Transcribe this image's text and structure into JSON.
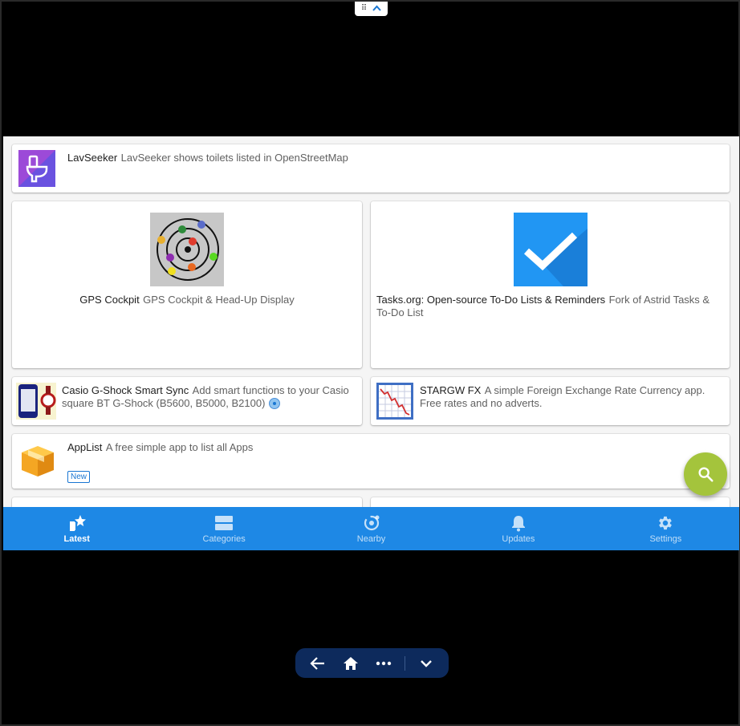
{
  "apps": {
    "lavseeker": {
      "name": "LavSeeker",
      "desc": "LavSeeker shows toilets listed in OpenStreetMap"
    },
    "gps_cockpit": {
      "name": "GPS Cockpit",
      "desc": "GPS Cockpit & Head-Up Display"
    },
    "tasks_org": {
      "name": "Tasks.org: Open-source To-Do Lists & Reminders",
      "desc": "Fork of Astrid Tasks & To-Do List"
    },
    "casio": {
      "name": "Casio G-Shock Smart Sync",
      "desc": "Add smart functions to your Casio square BT G-Shock (B5600, B5000, B2100)"
    },
    "stargw": {
      "name": "STARGW FX",
      "desc": "A simple Foreign Exchange Rate Currency app. Free rates and no adverts."
    },
    "applist": {
      "name": "AppList",
      "desc": "A free simple app to list all Apps",
      "badge": "New"
    }
  },
  "bottom_nav": {
    "items": [
      {
        "label": "Latest",
        "icon": "star-icon",
        "active": true
      },
      {
        "label": "Categories",
        "icon": "categories-icon"
      },
      {
        "label": "Nearby",
        "icon": "nearby-icon"
      },
      {
        "label": "Updates",
        "icon": "bell-icon"
      },
      {
        "label": "Settings",
        "icon": "gear-icon"
      }
    ]
  },
  "colors": {
    "primary": "#1e88e5",
    "fab": "#a4c43c",
    "background": "#f5f5f5"
  },
  "system_nav": {
    "icons": [
      "back-arrow-icon",
      "home-icon",
      "more-icon",
      "chevron-down-icon"
    ]
  }
}
